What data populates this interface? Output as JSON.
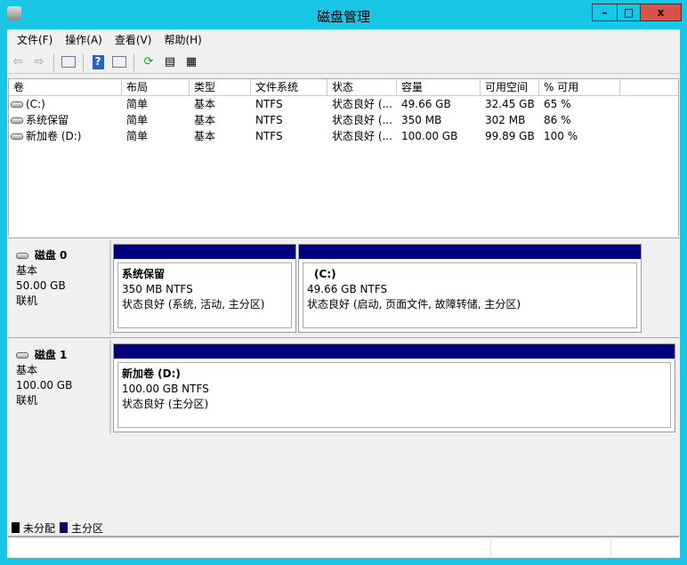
{
  "window": {
    "title": "磁盘管理",
    "minimize": "–",
    "maximize": "□",
    "close": "x"
  },
  "menu": [
    "文件(F)",
    "操作(A)",
    "查看(V)",
    "帮助(H)"
  ],
  "toolbar": {
    "icons": [
      "back-icon",
      "forward-icon",
      "show-hide-console-tree-icon",
      "help-icon",
      "show-action-pane-icon",
      "refresh-icon",
      "properties-icon",
      "rescan-icon"
    ]
  },
  "volume_list": {
    "columns": [
      "卷",
      "布局",
      "类型",
      "文件系统",
      "状态",
      "容量",
      "可用空间",
      "% 可用"
    ],
    "rows": [
      [
        "(C:)",
        "简单",
        "基本",
        "NTFS",
        "状态良好 (...",
        "49.66 GB",
        "32.45 GB",
        "65 %"
      ],
      [
        "系统保留",
        "简单",
        "基本",
        "NTFS",
        "状态良好 (...",
        "350 MB",
        "302 MB",
        "86 %"
      ],
      [
        "新加卷 (D:)",
        "简单",
        "基本",
        "NTFS",
        "状态良好 (...",
        "100.00 GB",
        "99.89 GB",
        "100 %"
      ]
    ]
  },
  "disks": [
    {
      "name": "磁盘 0",
      "type": "基本",
      "size": "50.00 GB",
      "state": "联机",
      "partitions": [
        {
          "name": "系统保留",
          "fs": "350 MB NTFS",
          "status": "状态良好 (系统, 活动, 主分区)"
        },
        {
          "name": "(C:)",
          "fs": "49.66 GB NTFS",
          "status": "状态良好 (启动, 页面文件, 故障转储, 主分区)"
        }
      ]
    },
    {
      "name": "磁盘 1",
      "type": "基本",
      "size": "100.00 GB",
      "state": "联机",
      "partitions": [
        {
          "name": "新加卷  (D:)",
          "fs": "100.00 GB NTFS",
          "status": "状态良好 (主分区)"
        }
      ]
    }
  ],
  "legend": [
    {
      "label": "未分配",
      "color": "#000000"
    },
    {
      "label": "主分区",
      "color": "#00007f"
    }
  ],
  "colors": {
    "frame": "#19c6e6",
    "partition_bar": "#00007f",
    "close": "#d9534a"
  }
}
